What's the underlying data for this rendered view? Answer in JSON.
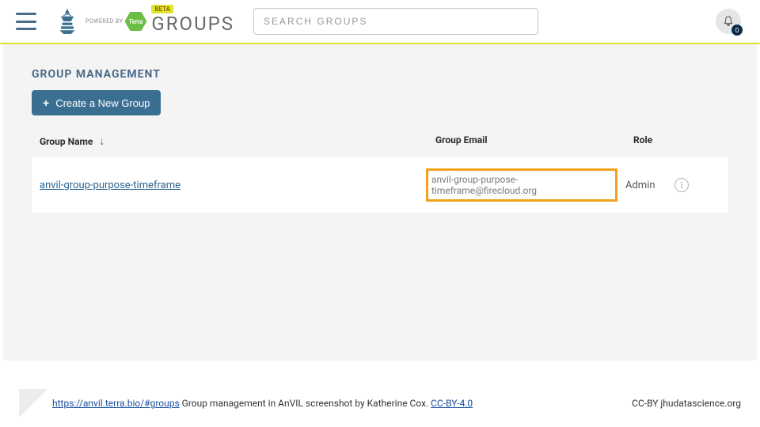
{
  "header": {
    "powered_text": "POWERED BY",
    "terra_text": "Terra",
    "beta_label": "BETA",
    "title": "GROUPS",
    "search_placeholder": "SEARCH GROUPS",
    "notification_count": "0"
  },
  "page": {
    "heading": "GROUP MANAGEMENT",
    "create_label": "Create a New Group"
  },
  "table": {
    "columns": {
      "name": "Group Name",
      "email": "Group Email",
      "role": "Role"
    },
    "rows": [
      {
        "name": "anvil-group-purpose-timeframe",
        "email": "anvil-group-purpose-timeframe@firecloud.org",
        "role": "Admin"
      }
    ]
  },
  "footer": {
    "url": "https://anvil.terra.bio/#groups",
    "caption_rest": " Group management in AnVIL screenshot by Katherine Cox.  ",
    "license_link": "CC-BY-4.0",
    "right": "CC-BY  jhudatascience.org"
  }
}
